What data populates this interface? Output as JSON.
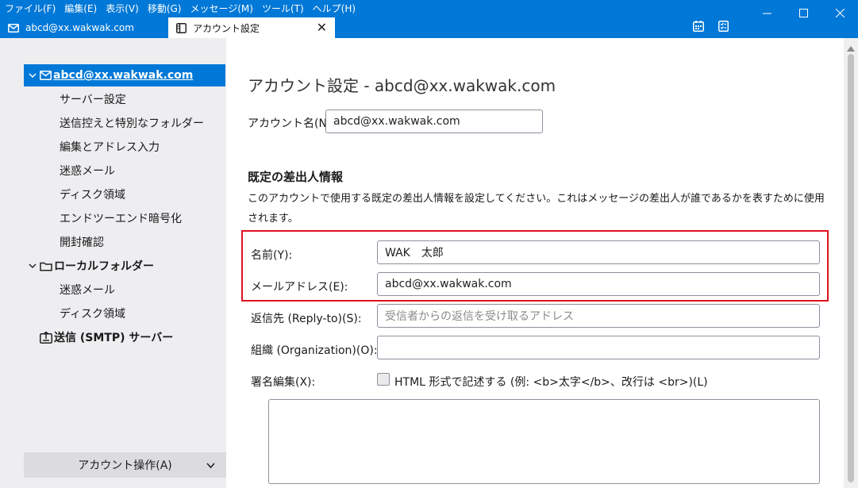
{
  "menubar": {
    "items": [
      "ファイル(F)",
      "編集(E)",
      "表示(V)",
      "移動(G)",
      "メッセージ(M)",
      "ツール(T)",
      "ヘルプ(H)"
    ]
  },
  "tabs": [
    {
      "label": "abcd@xx.wakwak.com",
      "icon": "mail-icon"
    },
    {
      "label": "アカウント設定",
      "icon": "settings-tab-icon",
      "active": true
    }
  ],
  "sidebar": {
    "items": [
      {
        "label": "abcd@xx.wakwak.com",
        "selected": true,
        "icon": "mail-icon"
      },
      {
        "label": "サーバー設定"
      },
      {
        "label": "送信控えと特別なフォルダー"
      },
      {
        "label": "編集とアドレス入力"
      },
      {
        "label": "迷惑メール"
      },
      {
        "label": "ディスク領域"
      },
      {
        "label": "エンドツーエンド暗号化"
      },
      {
        "label": "開封確認"
      },
      {
        "label": "ローカルフォルダー",
        "icon": "folder-icon"
      },
      {
        "label": "迷惑メール"
      },
      {
        "label": "ディスク領域"
      },
      {
        "label": "送信 (SMTP) サーバー",
        "icon": "outgoing-server-icon"
      }
    ],
    "account_ops": "アカウント操作(A)"
  },
  "main": {
    "title": "アカウント設定 - abcd@xx.wakwak.com",
    "account_name_label": "アカウント名(N):",
    "account_name_value": "abcd@xx.wakwak.com",
    "identity_heading": "既定の差出人情報",
    "identity_desc": "このアカウントで使用する既定の差出人情報を設定してください。これはメッセージの差出人が誰であるかを表すために使用されます。",
    "name_label": "名前(Y):",
    "name_value": "WAK　太郎",
    "email_label": "メールアドレス(E):",
    "email_value": "abcd@xx.wakwak.com",
    "replyto_label": "返信先 (Reply-to)(S):",
    "replyto_placeholder": "受信者からの返信を受け取るアドレス",
    "org_label": "組織 (Organization)(O):",
    "org_value": "",
    "signature_label": "署名編集(X):",
    "html_checkbox_label": "HTML 形式で記述する (例: <b>太字</b>、改行は <br>)(L)",
    "html_checked": false
  },
  "colors": {
    "accent": "#0078d7",
    "highlight_box": "#e0121f"
  }
}
